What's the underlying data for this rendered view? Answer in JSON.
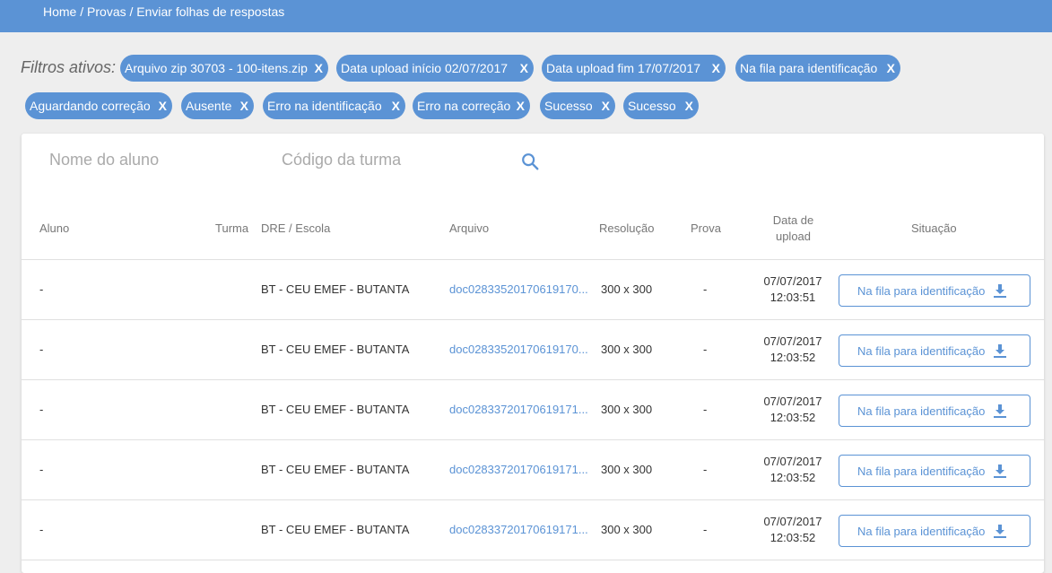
{
  "breadcrumb": {
    "home": "Home",
    "sep1": " / ",
    "provas": "Provas",
    "sep2": " / ",
    "current": "Enviar folhas de respostas"
  },
  "filters": {
    "label": "Filtros ativos:",
    "chips": [
      "Arquivo zip 30703 - 100-itens.zip",
      "Data upload início 02/07/2017",
      "Data upload fim 17/07/2017",
      "Na fila para identificação",
      "Aguardando correção",
      "Ausente",
      "Erro na identificação",
      "Erro na correção",
      "Sucesso",
      "Sucesso"
    ],
    "remove_label": "X"
  },
  "search": {
    "student_placeholder": "Nome do aluno",
    "class_placeholder": "Código da turma"
  },
  "table": {
    "headers": {
      "aluno": "Aluno",
      "turma": "Turma",
      "dre": "DRE / Escola",
      "arquivo": "Arquivo",
      "resolucao": "Resolução",
      "prova": "Prova",
      "data_upload_1": "Data de",
      "data_upload_2": "upload",
      "situacao": "Situação"
    },
    "rows": [
      {
        "aluno": "-",
        "turma": "",
        "dre": "BT - CEU EMEF - BUTANTA",
        "arquivo": "doc02833520170619170...",
        "resolucao": "300 x 300",
        "prova": "-",
        "date": "07/07/2017",
        "time": "12:03:51",
        "status": "Na fila para identificação"
      },
      {
        "aluno": "-",
        "turma": "",
        "dre": "BT - CEU EMEF - BUTANTA",
        "arquivo": "doc02833520170619170...",
        "resolucao": "300 x 300",
        "prova": "-",
        "date": "07/07/2017",
        "time": "12:03:52",
        "status": "Na fila para identificação"
      },
      {
        "aluno": "-",
        "turma": "",
        "dre": "BT - CEU EMEF - BUTANTA",
        "arquivo": "doc02833720170619171...",
        "resolucao": "300 x 300",
        "prova": "-",
        "date": "07/07/2017",
        "time": "12:03:52",
        "status": "Na fila para identificação"
      },
      {
        "aluno": "-",
        "turma": "",
        "dre": "BT - CEU EMEF - BUTANTA",
        "arquivo": "doc02833720170619171...",
        "resolucao": "300 x 300",
        "prova": "-",
        "date": "07/07/2017",
        "time": "12:03:52",
        "status": "Na fila para identificação"
      },
      {
        "aluno": "-",
        "turma": "",
        "dre": "BT - CEU EMEF - BUTANTA",
        "arquivo": "doc02833720170619171...",
        "resolucao": "300 x 300",
        "prova": "-",
        "date": "07/07/2017",
        "time": "12:03:52",
        "status": "Na fila para identificação"
      }
    ]
  },
  "icons": {
    "search": "search-icon",
    "download": "download-icon",
    "remove": "close-icon"
  },
  "colors": {
    "accent": "#5b93d5",
    "background": "#eeeeee"
  }
}
